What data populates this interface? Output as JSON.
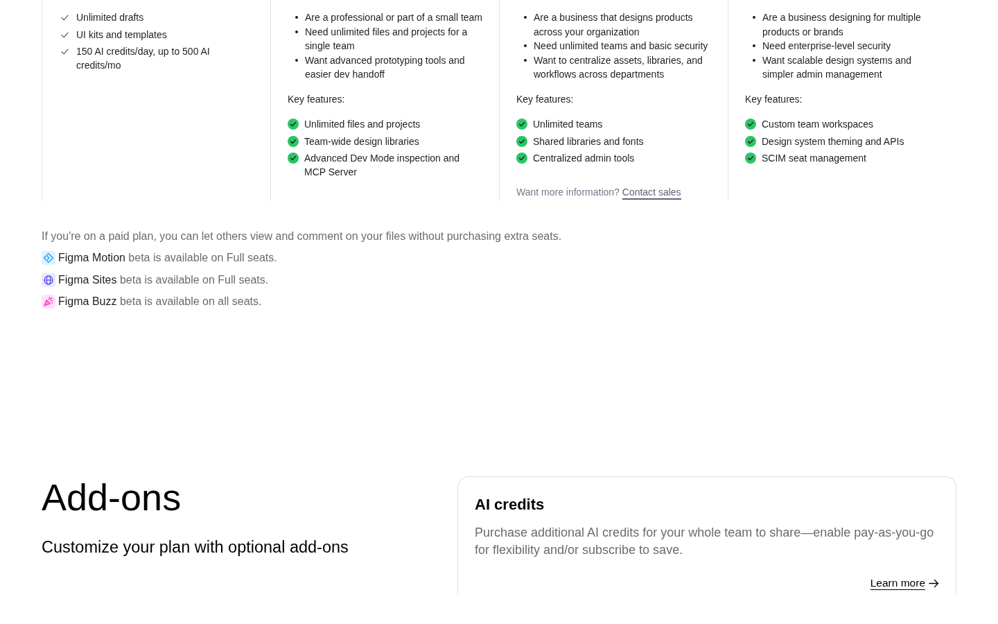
{
  "plan_columns": [
    {
      "kind": "checklist",
      "items": [
        "Unlimited drafts",
        "UI kits and templates",
        "150 AI credits/day, up to 500 AI credits/mo"
      ]
    },
    {
      "kind": "detailed",
      "audience": [
        "Are a professional or part of a small team",
        "Need unlimited files and projects for a single team",
        "Want advanced prototyping tools and easier dev handoff"
      ],
      "features_label": "Key features:",
      "features": [
        "Unlimited files and projects",
        "Team-wide design libraries",
        "Advanced Dev Mode inspection and MCP Server"
      ]
    },
    {
      "kind": "detailed",
      "audience": [
        "Are a business that designs products across your organization",
        "Need unlimited teams and basic security",
        "Want to centralize assets, libraries, and workflows across departments"
      ],
      "features_label": "Key features:",
      "features": [
        "Unlimited teams",
        "Shared libraries and fonts",
        "Centralized admin tools"
      ],
      "contact": {
        "text": "Want more information?",
        "link": "Contact sales"
      }
    },
    {
      "kind": "detailed",
      "audience": [
        "Are a business designing for multiple products or brands",
        "Need enterprise-level security",
        "Want scalable design systems and simpler admin management"
      ],
      "features_label": "Key features:",
      "features": [
        "Custom team workspaces",
        "Design system theming and APIs",
        "SCIM seat management"
      ]
    }
  ],
  "seats_note": "If you're on a paid plan, you can let others view and comment on your files without purchasing extra seats.",
  "beta_products": [
    {
      "kind": "diamond",
      "name": "Figma Motion",
      "text": "beta is available on Full seats."
    },
    {
      "kind": "globe",
      "name": "Figma Sites",
      "text": "beta is available on Full seats."
    },
    {
      "kind": "confetti",
      "name": "Figma Buzz",
      "text": "beta is available on all seats."
    }
  ],
  "addons": {
    "title": "Add-ons",
    "subtitle": "Customize your plan with optional add-ons",
    "cards": [
      {
        "title": "AI credits",
        "description": "Purchase additional AI credits for your whole team to share—enable pay-as-you-go for flexibility and/or subscribe to save.",
        "link": "Learn more"
      }
    ]
  }
}
